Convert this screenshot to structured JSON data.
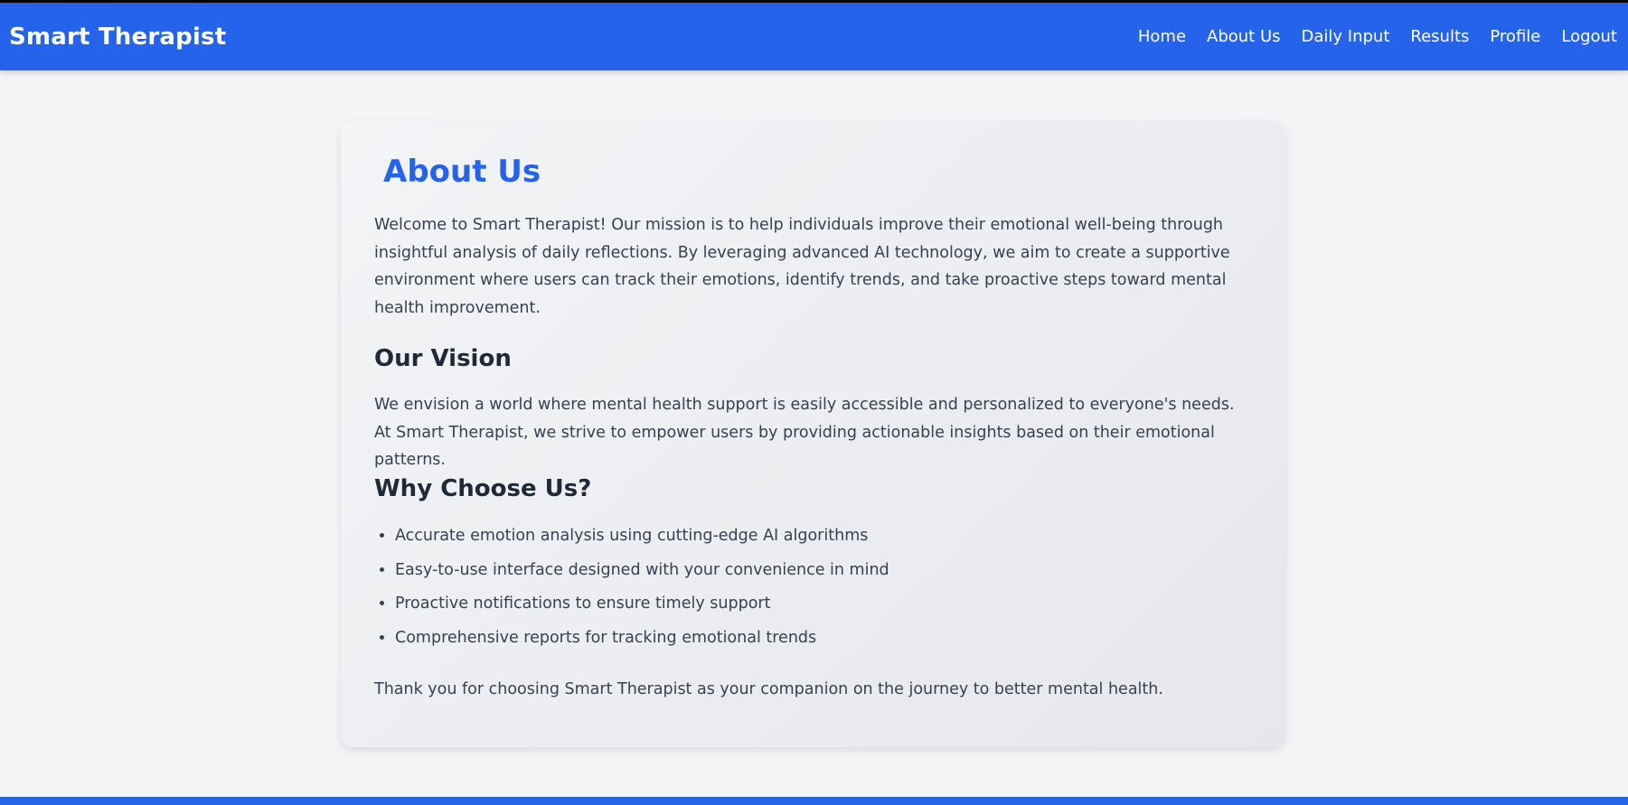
{
  "brand": {
    "name": "Smart Therapist"
  },
  "nav": {
    "links": [
      {
        "label": "Home"
      },
      {
        "label": "About Us"
      },
      {
        "label": "Daily Input"
      },
      {
        "label": "Results"
      },
      {
        "label": "Profile"
      },
      {
        "label": "Logout"
      }
    ]
  },
  "about": {
    "title": "About Us",
    "intro": "Welcome to Smart Therapist! Our mission is to help individuals improve their emotional well-being through insightful analysis of daily reflections. By leveraging advanced AI technology, we aim to create a supportive environment where users can track their emotions, identify trends, and take proactive steps toward mental health improvement.",
    "vision_heading": "Our Vision",
    "vision_text": "We envision a world where mental health support is easily accessible and personalized to everyone's needs. At Smart Therapist, we strive to empower users by providing actionable insights based on their emotional patterns.",
    "why_heading": "Why Choose Us?",
    "reasons": [
      "Accurate emotion analysis using cutting-edge AI algorithms",
      "Easy-to-use interface designed with your convenience in mind",
      "Proactive notifications to ensure timely support",
      "Comprehensive reports for tracking emotional trends"
    ],
    "closing": "Thank you for choosing Smart Therapist as your companion on the journey to better mental health."
  },
  "colors": {
    "primary": "#2563eb",
    "page_background": "#f3f4f6",
    "heading_text": "#1f2937",
    "body_text": "#374151"
  }
}
